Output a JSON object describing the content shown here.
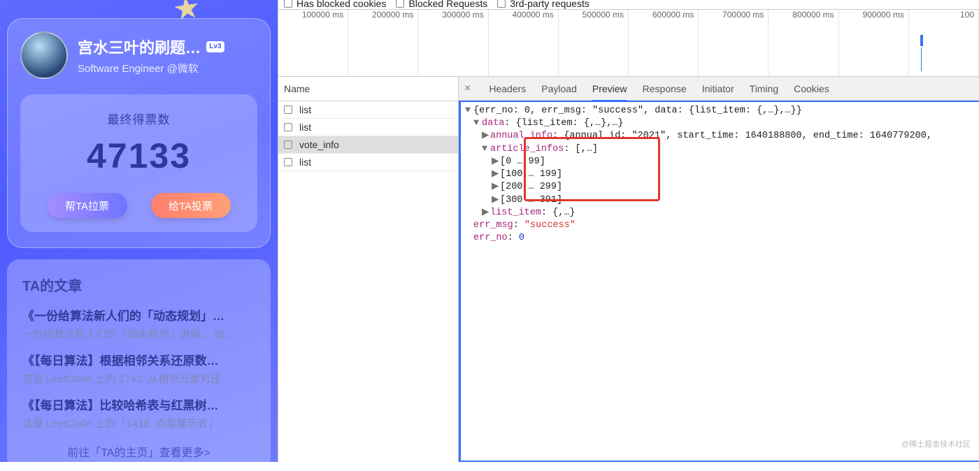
{
  "profile": {
    "name": "宫水三叶的刷题…",
    "level_badge": "Lv3",
    "subtitle": "Software Engineer @微软"
  },
  "vote": {
    "label": "最终得票数",
    "count": "47133",
    "help_btn": "帮TA拉票",
    "vote_btn": "给TA投票"
  },
  "articles": {
    "title": "TA的文章",
    "items": [
      {
        "head": "《一份给算法新人们的「动态规划」…",
        "desc": "一份给算法新人们的「动态规划」讲解。 动…"
      },
      {
        "head": "《【每日算法】根据相邻关系还原数…",
        "desc": "这是 LeetCode 上的 1743. 从相邻元素对还…"
      },
      {
        "head": "《【每日算法】比较哈希表与红黑树…",
        "desc": "这是 LeetCode 上的「1418. 点菜展示表」…"
      }
    ],
    "more": "前往「TA的主页」查看更多>"
  },
  "filters": {
    "blocked_cookies": "Has blocked cookies",
    "blocked_requests": "Blocked Requests",
    "third_party": "3rd-party requests"
  },
  "timeline_ticks": [
    "100000 ms",
    "200000 ms",
    "300000 ms",
    "400000 ms",
    "500000 ms",
    "600000 ms",
    "700000 ms",
    "800000 ms",
    "900000 ms",
    "100"
  ],
  "name_col_header": "Name",
  "requests": [
    {
      "label": "list",
      "selected": false
    },
    {
      "label": "list",
      "selected": false
    },
    {
      "label": "vote_info",
      "selected": true
    },
    {
      "label": "list",
      "selected": false
    }
  ],
  "detail_tabs": [
    "Headers",
    "Payload",
    "Preview",
    "Response",
    "Initiator",
    "Timing",
    "Cookies"
  ],
  "active_detail_tab": "Preview",
  "json_preview": {
    "root": "{err_no: 0, err_msg: \"success\", data: {list_item: {,…},…}}",
    "data": "data: {list_item: {,…},…}",
    "annual_info_key": "annual_info",
    "annual_info_val": ": {annual_id: \"2021\", start_time: 1640188800, end_time: 1640779200,",
    "article_infos": "article_infos: [,…]",
    "ranges": [
      "[0 … 99]",
      "[100 … 199]",
      "[200 … 299]",
      "[300 … 391]"
    ],
    "list_item": "list_item: {,…}",
    "err_msg_key": "err_msg",
    "err_msg_val": "\"success\"",
    "err_no_key": "err_no",
    "err_no_val": "0"
  },
  "watermark": "@稀土掘金技术社区"
}
